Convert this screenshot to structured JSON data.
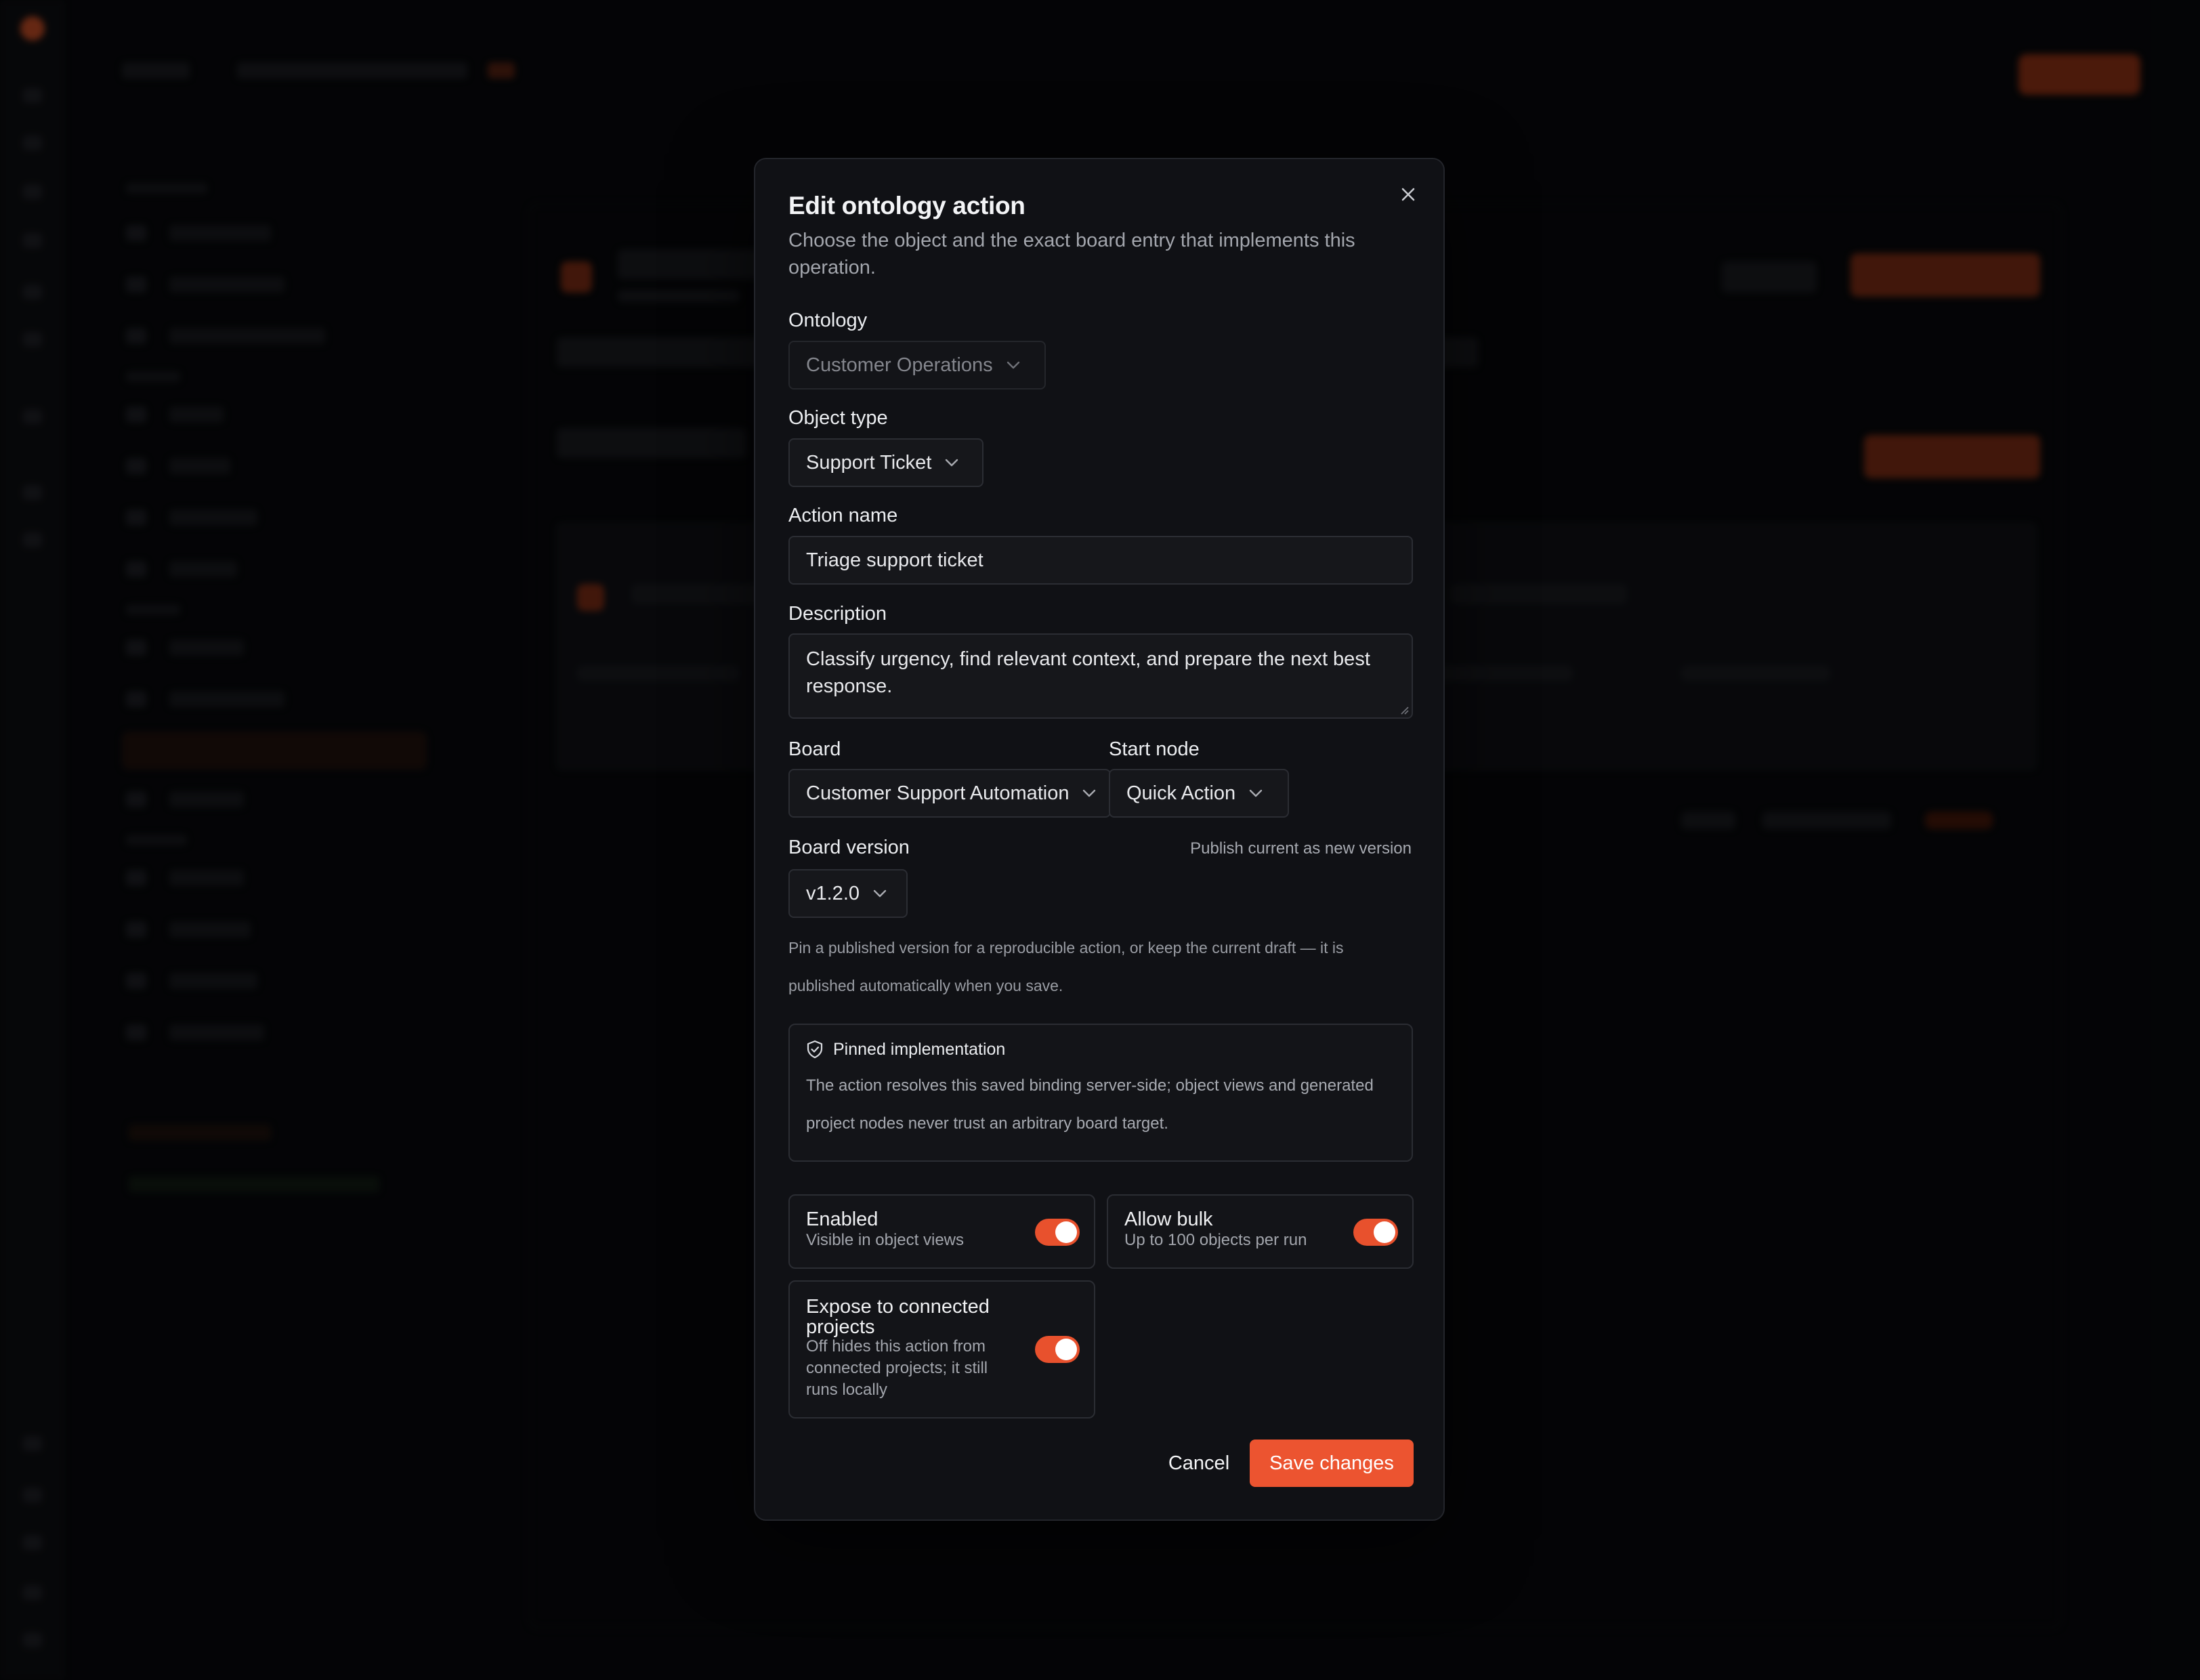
{
  "modal": {
    "title": "Edit ontology action",
    "subtitle": "Choose the object and the exact board entry that implements this operation."
  },
  "form": {
    "ontology": {
      "label": "Ontology",
      "value": "Customer Operations",
      "disabled": true
    },
    "object_type": {
      "label": "Object type",
      "value": "Support Ticket"
    },
    "action_name": {
      "label": "Action name",
      "value": "Triage support ticket"
    },
    "description": {
      "label": "Description",
      "value": "Classify urgency, find relevant context, and prepare the next best response."
    },
    "board": {
      "label": "Board",
      "value": "Customer Support Automation"
    },
    "start_node": {
      "label": "Start node",
      "value": "Quick Action"
    },
    "board_version": {
      "label": "Board version",
      "value": "v1.2.0",
      "publish_link": "Publish current as new version",
      "hint": "Pin a published version for a reproducible action, or keep the current draft — it is published automatically when you save."
    },
    "pinned": {
      "title": "Pinned implementation",
      "text": "The action resolves this saved binding server-side; object views and generated project nodes never trust an arbitrary board target."
    },
    "toggles": {
      "enabled": {
        "title": "Enabled",
        "subtitle": "Visible in object views",
        "on": true
      },
      "allow_bulk": {
        "title": "Allow bulk",
        "subtitle": "Up to 100 objects per run",
        "on": true
      },
      "expose": {
        "title": "Expose to connected projects",
        "subtitle": "Off hides this action from connected projects; it still runs locally",
        "on": true
      }
    }
  },
  "actions": {
    "cancel": "Cancel",
    "save": "Save changes"
  },
  "colors": {
    "accent": "#ec5430",
    "modal_bg": "#101115",
    "border": "#2b2d33"
  },
  "icons": {
    "close": "close-icon",
    "chevron": "chevron-down-icon",
    "pinned": "shield-check-icon"
  }
}
